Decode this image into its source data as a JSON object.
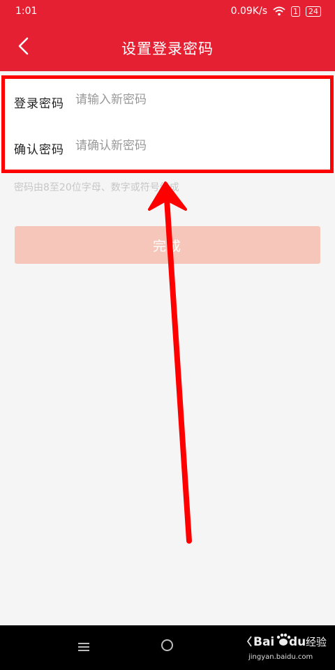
{
  "status_bar": {
    "time": "1:01",
    "network_speed": "0.09K/s",
    "sim_indicator": "1",
    "battery": "24"
  },
  "header": {
    "title": "设置登录密码",
    "back_icon": "chevron-left-icon"
  },
  "form": {
    "login_password": {
      "label": "登录密码",
      "placeholder": "请输入新密码",
      "value": ""
    },
    "confirm_password": {
      "label": "确认密码",
      "placeholder": "请确认新密码",
      "value": ""
    }
  },
  "hint": "密码由8至20位字母、数字或符号组成",
  "done_button": {
    "label": "完成",
    "color": "#f5c6b9"
  },
  "colors": {
    "brand": "#e52032",
    "annotation": "#ff0000"
  },
  "watermark": {
    "brand": "Bai",
    "brand_suffix": "du",
    "product": "经验",
    "url": "jingyan.baidu.com"
  }
}
